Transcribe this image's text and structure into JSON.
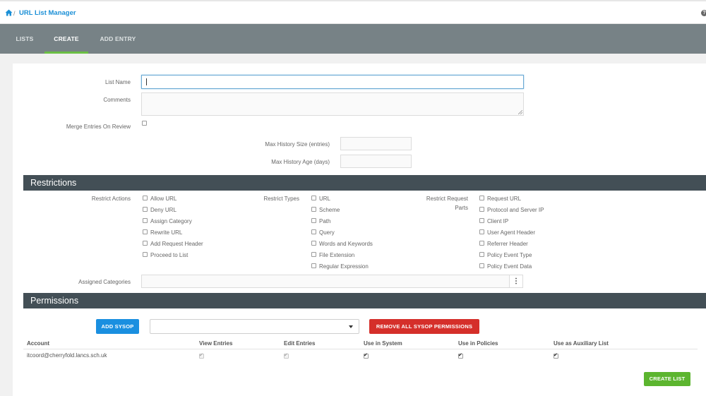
{
  "breadcrumb": {
    "separator": "/",
    "title": "URL List Manager",
    "help_glyph": "?"
  },
  "tabs": [
    {
      "label": "LISTS",
      "active": false
    },
    {
      "label": "CREATE",
      "active": true
    },
    {
      "label": "ADD ENTRY",
      "active": false
    }
  ],
  "form": {
    "list_name_label": "List Name",
    "list_name_value": "",
    "comments_label": "Comments",
    "comments_value": "",
    "merge_label": "Merge Entries On Review",
    "merge_checked": false,
    "max_history_size_label": "Max History Size (entries)",
    "max_history_size_value": "",
    "max_history_age_label": "Max History Age (days)",
    "max_history_age_value": ""
  },
  "restrictions": {
    "title": "Restrictions",
    "actions_label": "Restrict Actions",
    "actions": [
      "Allow URL",
      "Deny URL",
      "Assign Category",
      "Rewrite URL",
      "Add Request Header",
      "Proceed to List"
    ],
    "types_label": "Restrict Types",
    "types": [
      "URL",
      "Scheme",
      "Path",
      "Query",
      "Words and Keywords",
      "File Extension",
      "Regular Expression"
    ],
    "parts_label_line1": "Restrict Request",
    "parts_label_line2": "Parts",
    "parts": [
      "Request URL",
      "Protocol and Server IP",
      "Client IP",
      "User Agent Header",
      "Referrer Header",
      "Policy Event Type",
      "Policy Event Data"
    ],
    "assigned_categories_label": "Assigned Categories",
    "assigned_categories_value": "",
    "kebab_glyph": "⋮"
  },
  "permissions": {
    "title": "Permissions",
    "add_sysop_label": "ADD SYSOP",
    "sysop_select_value": "",
    "remove_all_label": "REMOVE ALL SYSOP PERMISSIONS",
    "columns": [
      "Account",
      "View Entries",
      "Edit Entries",
      "Use in System",
      "Use in Policies",
      "Use as Auxiliary List"
    ],
    "rows": [
      {
        "account": "itcoord@cherryfold.lancs.sch.uk",
        "view_entries": true,
        "edit_entries": true,
        "use_in_system": true,
        "use_in_policies": true,
        "use_as_auxiliary": true
      }
    ]
  },
  "create_list_label": "CREATE LIST",
  "colors": {
    "accent_blue": "#1a8fe0",
    "danger_red": "#d52f2a",
    "success_green": "#5cb52f",
    "nav_bar": "#778286",
    "section_header": "#434f56",
    "active_tab_underline": "#6bbf45"
  }
}
